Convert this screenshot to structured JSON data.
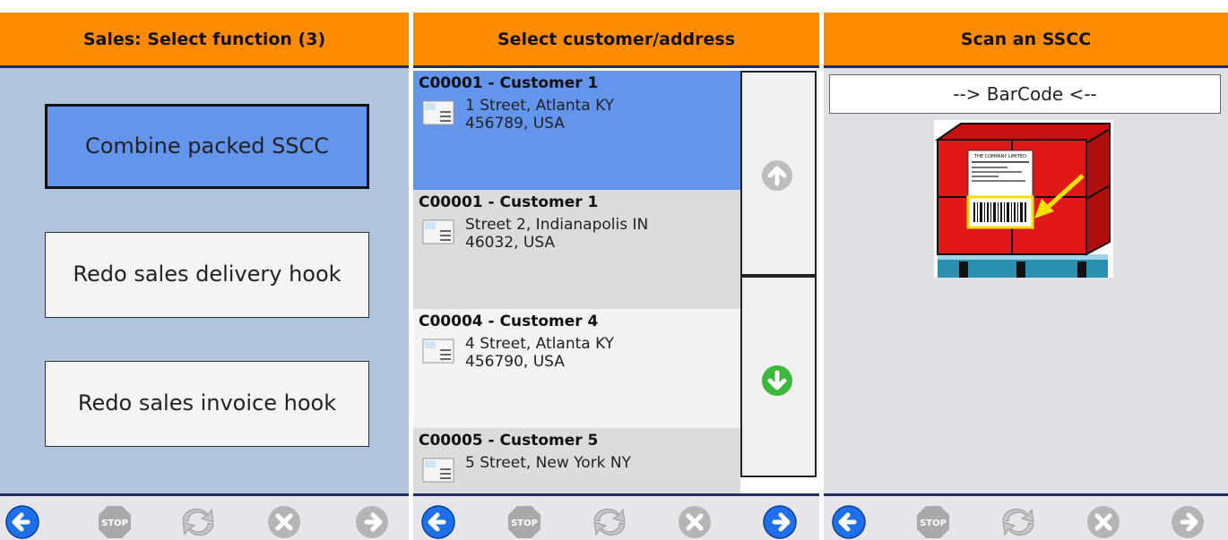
{
  "panels": [
    {
      "header": "Sales: Select function (3)",
      "buttons": [
        "Combine packed SSCC",
        "Redo sales delivery hook",
        "Redo sales invoice hook"
      ]
    },
    {
      "header": "Select customer/address",
      "customers": [
        {
          "name": "C00001 - Customer 1",
          "addr1": "1 Street, Atlanta KY",
          "addr2": "456789, USA"
        },
        {
          "name": "C00001 - Customer 1",
          "addr1": "Street 2, Indianapolis IN",
          "addr2": "46032, USA"
        },
        {
          "name": "C00004 - Customer 4",
          "addr1": "4 Street, Atlanta KY",
          "addr2": "456790, USA"
        },
        {
          "name": "C00005 - Customer 5",
          "addr1": "5 Street, New York NY",
          "addr2": ""
        }
      ]
    },
    {
      "header": "Scan an SSCC",
      "barcode_field": "--> BarCode <--",
      "pallet_label_text": "THE COMPANY LIMITED"
    }
  ],
  "toolbar": {
    "stop_label": "STOP"
  },
  "colors": {
    "header": "#ff8c00",
    "selected": "#6495ed",
    "panel1_bg": "#b0c4de"
  }
}
